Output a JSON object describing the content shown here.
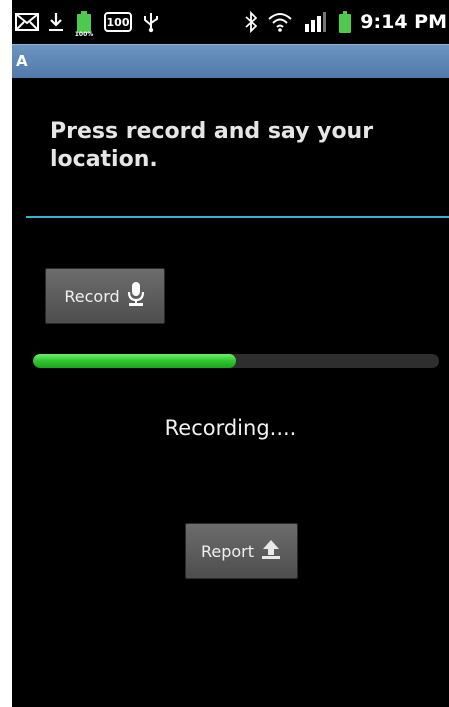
{
  "statusbar": {
    "time": "9:14 PM",
    "battery_small_label": "100%",
    "battery_badge_label": "100",
    "icons": [
      "mail-icon",
      "download-icon",
      "battery-charging-icon",
      "battery-100-badge-icon",
      "usb-icon",
      "bluetooth-icon",
      "wifi-icon",
      "signal-bars-icon",
      "battery-icon"
    ],
    "background": "#000000"
  },
  "app": {
    "title": "A",
    "titlebar_color": "#5a83b4"
  },
  "main": {
    "prompt": "Press record and say your location.",
    "divider_color": "#33b5cf",
    "record_button": {
      "label": "Record",
      "icon": "microphone-icon"
    },
    "progress": {
      "value": 0.5,
      "color": "#3cd43c"
    },
    "status": "Recording....",
    "report_button": {
      "label": "Report",
      "icon": "upload-icon"
    }
  }
}
